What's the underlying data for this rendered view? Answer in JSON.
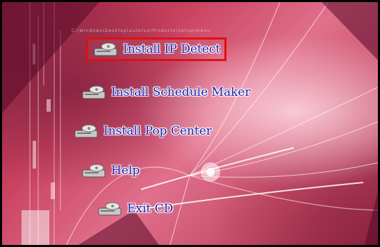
{
  "window": {
    "caption_strip": "C:\\Windows\\Desktop\\autorun\\Products\\Setup\\menu"
  },
  "menu": {
    "items": [
      {
        "label": "Install IP Detect",
        "icon": "cd-drive-icon",
        "selected": true
      },
      {
        "label": "Install Schedule Maker",
        "icon": "cd-drive-icon",
        "selected": false
      },
      {
        "label": "Install Pop Center",
        "icon": "cd-drive-icon",
        "selected": false
      },
      {
        "label": "Help",
        "icon": "cd-drive-icon",
        "selected": false
      },
      {
        "label": "Exit CD",
        "icon": "cd-drive-icon",
        "selected": false
      }
    ]
  },
  "colors": {
    "label_text": "#1a1aa8",
    "selection_border": "#e01010",
    "frame_border": "#000000"
  }
}
